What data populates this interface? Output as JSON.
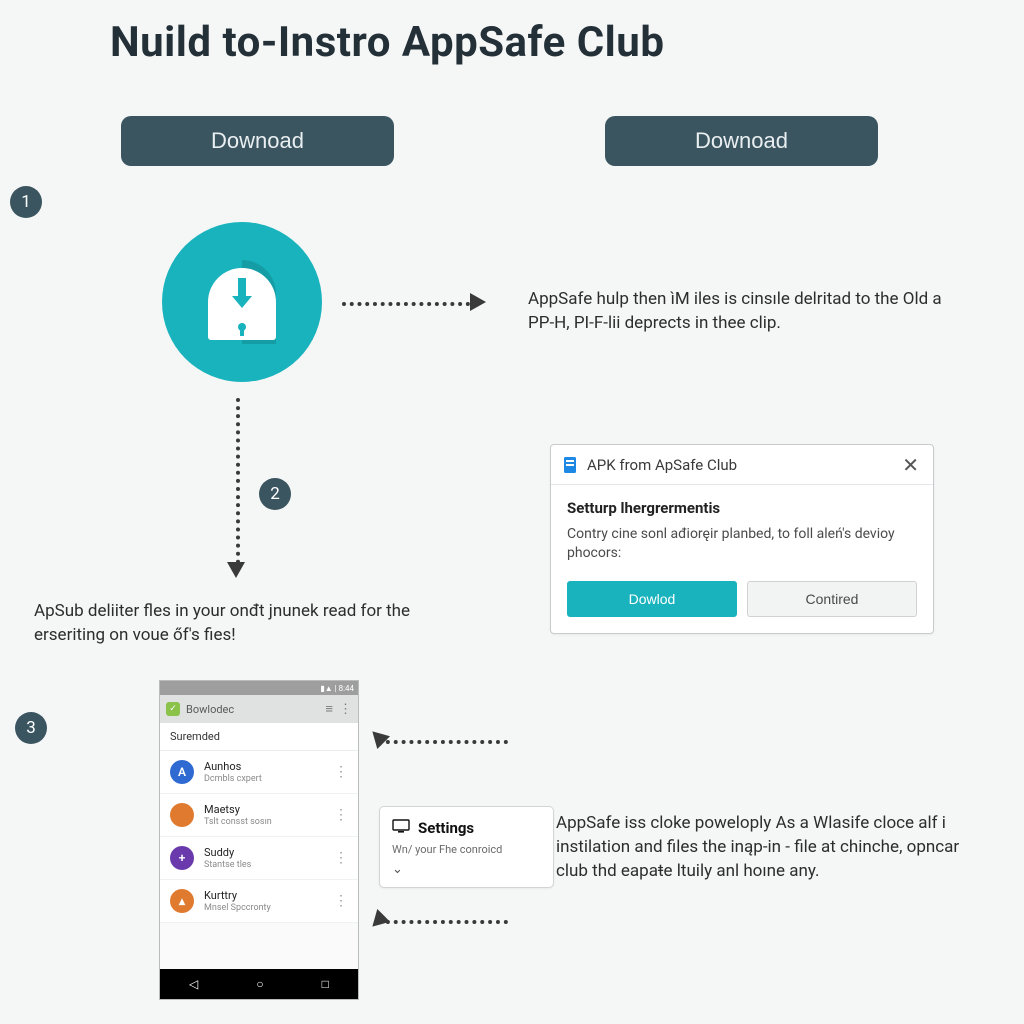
{
  "title": "Nuild to-Instro AppSafe Club",
  "buttons": {
    "download_left": "Downoad",
    "download_right": "Downoad"
  },
  "steps": {
    "one": "1",
    "two": "2",
    "three": "3"
  },
  "paragraphs": {
    "p1": "AppSafe hulp then ìM iles is cinsıle delritad to the Old a PP-H, PI-F-lii deprects in thee clip.",
    "p2": "ApSub deliiter fles in your onđt jnunek read for the erseriting on voue őf's fies!",
    "p3": "AppSafe iss cloke poweloply As a Wlasife cloce alf i instilation and files the inąp-in - file at chinche, opncar club thd eapaŧe ltuily anl hoıne any."
  },
  "dialog": {
    "window_title": "APK from ApSafe Club",
    "subtitle": "Setturp lhergrermentis",
    "body": "Contry cine sonl ađioręir planbed, to foll aleń's devioy phocors:",
    "primary": "Dowlod",
    "secondary": "Contired",
    "close": "✕"
  },
  "phone": {
    "status": "▮▲ | 8:44",
    "appbar_title": "Bowlodec",
    "section": "Suremded",
    "rows": [
      {
        "label": "Aunhos",
        "sub": "Dcmbls cxpert",
        "color": "#2e6ad1",
        "letter": "A"
      },
      {
        "label": "Maetsy",
        "sub": "Tslt consst sosın",
        "color": "#e07a2e",
        "letter": ""
      },
      {
        "label": "Suddy",
        "sub": "Stantse tles",
        "color": "#6a3aad",
        "letter": "+"
      },
      {
        "label": "Kurttry",
        "sub": "Mnsel Spccronty",
        "color": "#e07a2e",
        "letter": "▴"
      }
    ],
    "nav": {
      "back": "◁",
      "home": "○",
      "recent": "□"
    }
  },
  "settings_card": {
    "title": "Settings",
    "subtitle": "Wn/ your Fhe conroicd",
    "chevron": "⌄"
  },
  "icons": {
    "file": "📄",
    "monitor": "⬜"
  }
}
